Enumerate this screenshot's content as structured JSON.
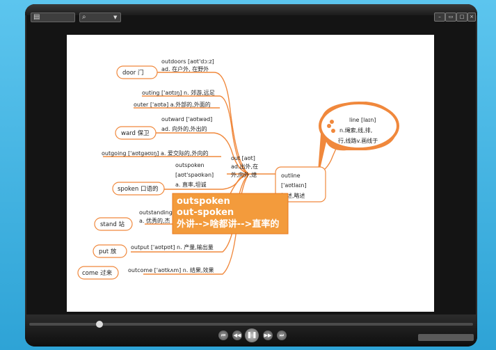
{
  "window": {
    "title": ""
  },
  "mindmap": {
    "nodes": [
      {
        "key": "door",
        "word": "door 门"
      },
      {
        "key": "ward",
        "word": "ward 保卫"
      },
      {
        "key": "spoken",
        "word": "spoken 口语的"
      },
      {
        "key": "stand",
        "word": "stand 站"
      },
      {
        "key": "put",
        "word": "put 放"
      },
      {
        "key": "come",
        "word": "come 过来"
      }
    ],
    "texts": {
      "outdoors_word": "outdoors [aʊt'dɔ:z]",
      "outdoors_meaning": "ad. 在户外, 在野外",
      "outing": "outing ['aʊtɪŋ] n. 郊游,远足",
      "outer": "outer ['aʊtə] a.外部的,外面的",
      "outward_word": "outward ['aʊtwəd]",
      "outward_meaning": "ad. 向外的,外出的",
      "outgoing": "outgoing ['aʊtgəʊɪŋ] a. 爱交际的,外向的",
      "outspoken_word": "outspoken",
      "outspoken_phon": "[aʊt'spəʊkən]",
      "outspoken_meaning": "a. 直率,坦诚",
      "outstanding_word": "outstanding",
      "outstanding_meaning": "a. 优秀的,杰",
      "output": "output ['aʊtpʊt] n. 产量,输出量",
      "outcome": "outcome ['aʊtkʌm] n. 结果,效果",
      "out_word": "out [aʊt]",
      "out_meaning1": "ad.出外,在",
      "out_meaning2": "外,向外,熄",
      "outline_word": "outline",
      "outline_phon": "['aʊtlaɪn]",
      "outline_meaning": "概述,略述",
      "line_word": "line [laɪn]",
      "line_meaning1": "n.绳索,线,排,",
      "line_meaning2": "行,线路v.画线于"
    },
    "popup": {
      "line1": "outspoken",
      "line2": "out-spoken",
      "line3": "外讲-->啥都讲-->直率的"
    }
  },
  "colors": {
    "branch": "#f0883c",
    "popup": "#f39b3c",
    "accent": "#e8781e"
  },
  "icons": [
    "search-icon",
    "prev-icon",
    "rewind-icon",
    "play-pause-icon",
    "forward-icon",
    "next-icon"
  ]
}
